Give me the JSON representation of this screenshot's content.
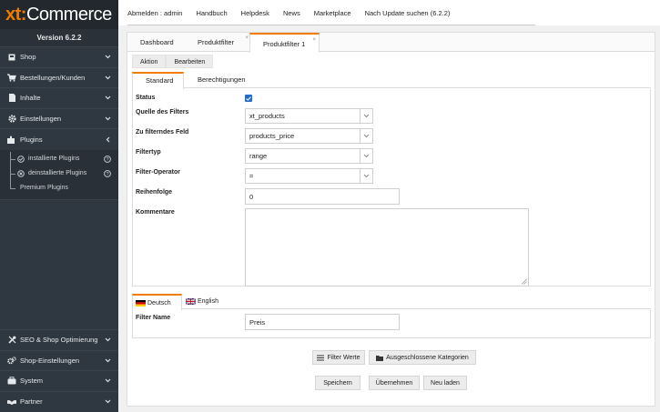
{
  "logo": {
    "brand_xt": "xt:",
    "brand_rest": "Commerce"
  },
  "version": "Version 6.2.2",
  "topbar": {
    "links": [
      "Abmelden : admin",
      "Handbuch",
      "Helpdesk",
      "News",
      "Marketplace",
      "Nach Update suchen (6.2.2)"
    ]
  },
  "sidebar": {
    "items": [
      {
        "label": "Shop",
        "icon": "store-icon"
      },
      {
        "label": "Bestellungen/Kunden",
        "icon": "cart-icon"
      },
      {
        "label": "Inhalte",
        "icon": "document-icon"
      },
      {
        "label": "Einstellungen",
        "icon": "gear-icon"
      },
      {
        "label": "Plugins",
        "icon": "puzzle-icon"
      }
    ],
    "sub_items": [
      {
        "label": "installierte Plugins",
        "icon": "check-circle-icon",
        "help": "?"
      },
      {
        "label": "deinstallierte Plugins",
        "icon": "x-circle-icon",
        "help": "?"
      },
      {
        "label": "Premium Plugins"
      }
    ],
    "bottom_items": [
      {
        "label": "SEO & Shop Optimierung",
        "icon": "tools-icon"
      },
      {
        "label": "Shop-Einstellungen",
        "icon": "gears-icon"
      },
      {
        "label": "System",
        "icon": "briefcase-icon"
      },
      {
        "label": "Partner",
        "icon": "handshake-icon"
      }
    ]
  },
  "tabs": {
    "dashboard": "Dashboard",
    "produktfilter": "Produktfilter",
    "produktfilter1": "Produktfilter 1",
    "close": "×"
  },
  "actions": {
    "aktion": "Aktion",
    "bearbeiten": "Bearbeiten"
  },
  "subtabs": {
    "standard": "Standard",
    "berechtigungen": "Berechtigungen"
  },
  "form": {
    "status_label": "Status",
    "status_checked": true,
    "quelle_label": "Quelle des Filters",
    "quelle_value": "xt_products",
    "feld_label": "Zu filterndes Feld",
    "feld_value": "products_price",
    "typ_label": "Filtertyp",
    "typ_value": "range",
    "operator_label": "Filter-Operator",
    "operator_value": "=",
    "reihenfolge_label": "Reihenfolge",
    "reihenfolge_value": "0",
    "kommentare_label": "Kommentare",
    "kommentare_value": ""
  },
  "lang": {
    "deutsch": "Deutsch",
    "english": "English",
    "filter_name_label": "Filter Name",
    "filter_name_value": "Preis"
  },
  "buttons": {
    "filter_werte": "Filter Werte",
    "ausgeschlossene": "Ausgeschlossene Kategorien",
    "speichern": "Speichern",
    "uebernehmen": "Übernehmen",
    "neu_laden": "Neu laden"
  },
  "colors": {
    "accent": "#f07d00",
    "sidebar": "#2f3740",
    "checkbox": "#1f6dd1"
  }
}
